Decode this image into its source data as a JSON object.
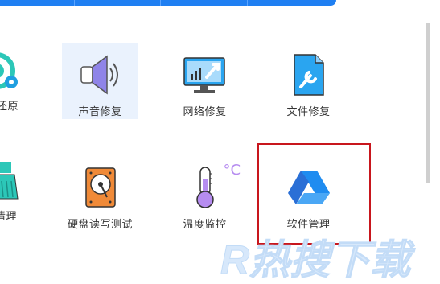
{
  "tools": {
    "row1": [
      {
        "label": "还原",
        "icon": "restore-icon"
      },
      {
        "label": "声音修复",
        "icon": "speaker-icon",
        "selected": true
      },
      {
        "label": "网络修复",
        "icon": "network-repair-icon"
      },
      {
        "label": "文件修复",
        "icon": "file-repair-icon"
      }
    ],
    "row2": [
      {
        "label": "清理",
        "icon": "broom-icon"
      },
      {
        "label": "硬盘读写测试",
        "icon": "hard-disk-icon"
      },
      {
        "label": "温度监控",
        "icon": "thermometer-icon",
        "unit": "°C"
      },
      {
        "label": "软件管理",
        "icon": "drive-triangle-icon"
      }
    ]
  },
  "watermark": {
    "text": "R热搜下载"
  },
  "colors": {
    "accent_blue": "#1f7ff2",
    "highlight_red": "#c8161d",
    "selected_bg": "#eaf2fd",
    "speaker_purple": "#8f84e8",
    "disk_orange": "#f08a38",
    "thermo_purple": "#b68cf0",
    "teal": "#2cc7b8"
  }
}
